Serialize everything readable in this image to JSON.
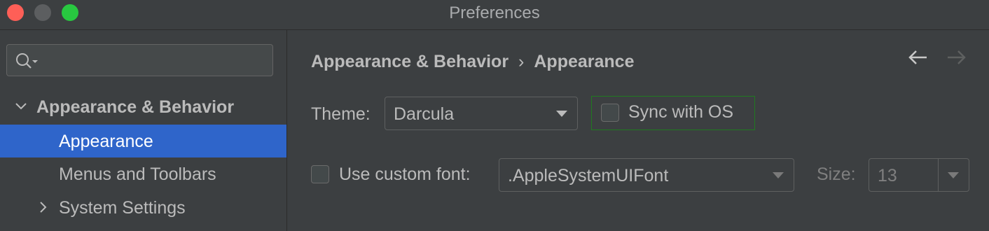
{
  "window": {
    "title": "Preferences",
    "controls": [
      "close-icon",
      "minimize-icon",
      "zoom-icon"
    ]
  },
  "sidebar": {
    "search": {
      "value": "",
      "placeholder": "",
      "icon": "search-icon"
    },
    "items": [
      {
        "label": "Appearance & Behavior",
        "expanded": true,
        "icon": "chevron-down-icon"
      },
      {
        "label": "Appearance",
        "selected": true
      },
      {
        "label": "Menus and Toolbars"
      },
      {
        "label": "System Settings",
        "expanded": false,
        "icon": "chevron-right-icon"
      }
    ]
  },
  "breadcrumb": {
    "parent": "Appearance & Behavior",
    "separator": "›",
    "current": "Appearance",
    "back_icon": "arrow-left-icon",
    "forward_icon": "arrow-right-icon"
  },
  "theme": {
    "label": "Theme:",
    "selected": "Darcula",
    "sync_label": "Sync with OS",
    "sync_checked": false
  },
  "font": {
    "use_custom_label": "Use custom font:",
    "use_custom_checked": false,
    "selected": ".AppleSystemUIFont",
    "size_label": "Size:",
    "size_value": "13"
  },
  "colors": {
    "background": "#3c3f41",
    "selection": "#2f65ca",
    "focus_border": "#207a20",
    "text": "#bbbbbb",
    "disabled_text": "#7f7f7f"
  }
}
